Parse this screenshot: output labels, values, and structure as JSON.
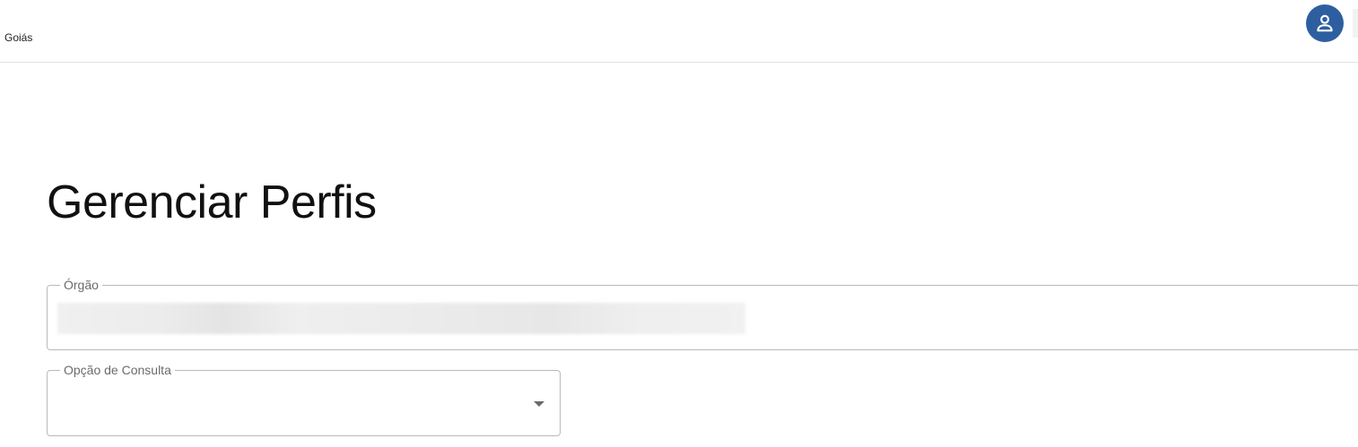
{
  "header": {
    "brand_text": "Goiás",
    "avatar_icon": "user-icon",
    "avatar_color": "#2d5fa0"
  },
  "main": {
    "title": "Gerenciar Perfis",
    "orgao_field": {
      "label": "Órgão",
      "value": ""
    },
    "consulta_field": {
      "label": "Opção de Consulta",
      "value": "",
      "dropdown_icon": "chevron-down-icon"
    }
  }
}
